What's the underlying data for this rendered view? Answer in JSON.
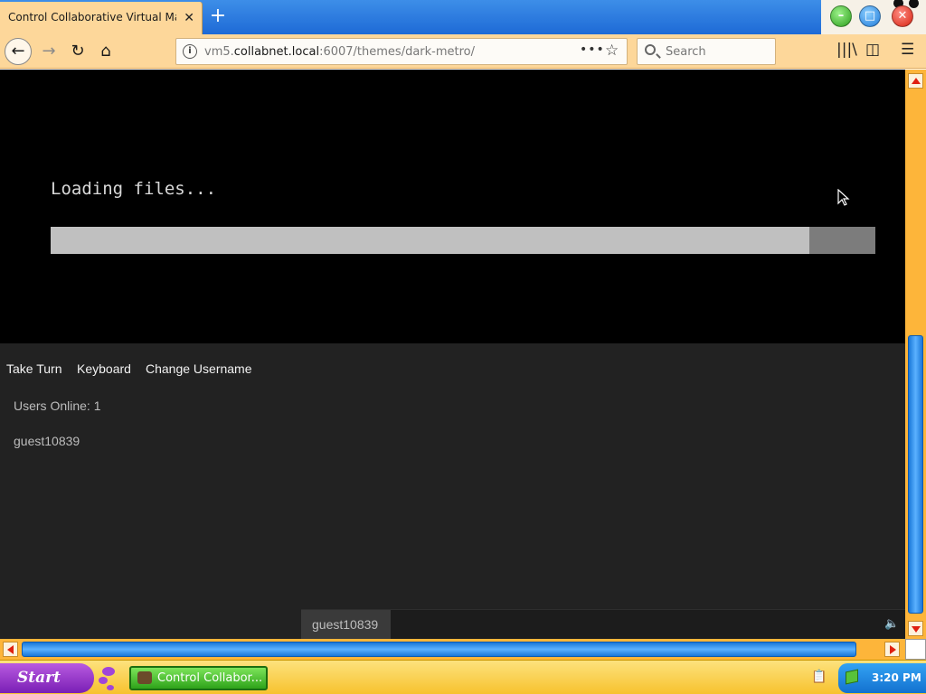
{
  "browser": {
    "tab": {
      "title": "Control Collaborative Virtual Ma",
      "close_glyph": "✕"
    },
    "new_tab_glyph": "+",
    "nav": {
      "back_glyph": "←",
      "forward_glyph": "→",
      "reload_glyph": "↻",
      "home_glyph": "⌂"
    },
    "url": {
      "host_prefix": "vm5.",
      "host_main": "collabnet.local",
      "path": ":6007/themes/dark-metro/"
    },
    "page_actions_glyph": "•••",
    "bookmark_glyph": "☆",
    "search_placeholder": "Search",
    "library_glyph": "|||\\",
    "sidebar_glyph": "◫",
    "menu_glyph": "☰",
    "window": {
      "min_glyph": "–",
      "max_glyph": "□",
      "close_glyph": "✕"
    }
  },
  "vm": {
    "loading_text": "Loading files...",
    "progress": 0.92
  },
  "toolbar": {
    "take_turn": "Take Turn",
    "keyboard": "Keyboard",
    "change_username": "Change Username"
  },
  "users": {
    "online_label": "Users Online: 1",
    "list": [
      "guest10839"
    ]
  },
  "chat": {
    "username": "guest10839",
    "input_value": "",
    "volume_glyph": "🔈"
  },
  "taskbar": {
    "start_label": "Start",
    "app_label": "Control Collabor...",
    "clip_glyph": "📋",
    "clock": "3:20 PM"
  },
  "colors": {
    "title_gradient": "#1e6ad6",
    "navbar": "#fdd79a",
    "vm_screen": "#000000",
    "panel_bg": "#222222",
    "scrollbar": "#fdb53a",
    "scroll_thumb": "#1977d8",
    "taskbar": "#f7c22e",
    "start": "#7a1fb5",
    "taskbar_app": "#2ea31a"
  }
}
